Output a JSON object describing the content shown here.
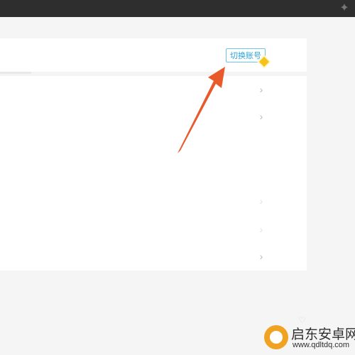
{
  "topbar": {
    "icon": "sparkle-icon"
  },
  "header": {
    "switch_account_label": "切换账号"
  },
  "rows": [
    {
      "chevron": "›"
    },
    {
      "chevron": "›"
    },
    {
      "value": ""
    },
    {
      "chevron": "›"
    },
    {
      "chevron": "›"
    },
    {
      "chevron": "›"
    }
  ],
  "watermark": {
    "title": "启东安卓网",
    "url": "www.qdltdq.com"
  },
  "colors": {
    "accent": "#2aa3d6",
    "arrow": "#e85a2b",
    "topbar": "#2e2e2e"
  }
}
